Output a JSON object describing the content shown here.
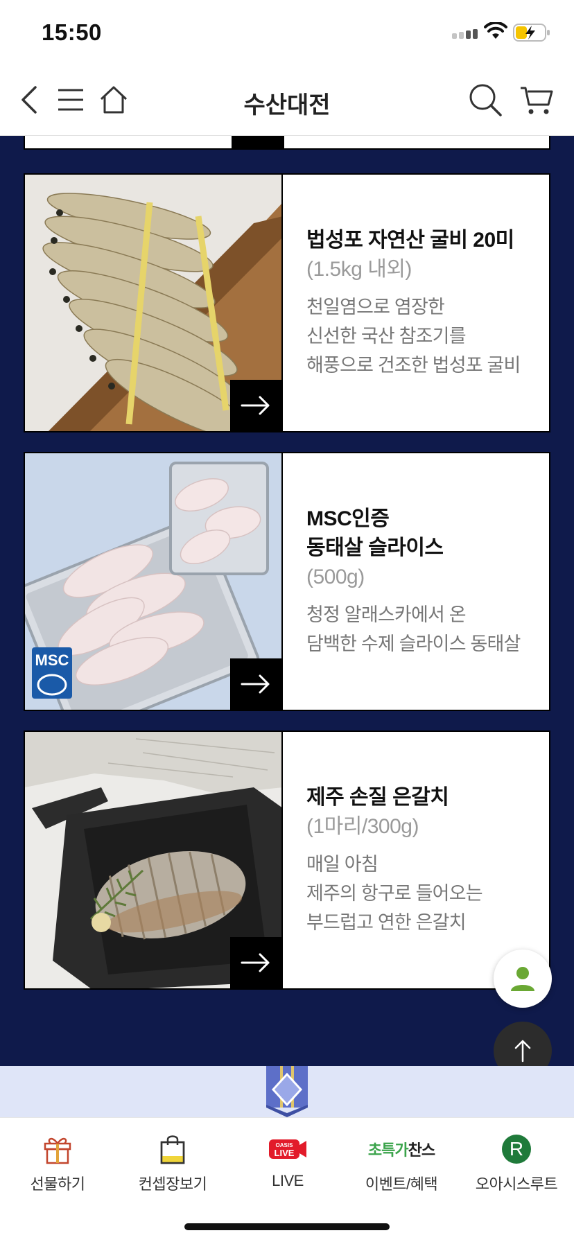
{
  "status_bar": {
    "time": "15:50"
  },
  "nav": {
    "title": "수산대전"
  },
  "products": [
    {
      "name_lines": [
        "법성포 자연산 굴비 20미"
      ],
      "weight": "(1.5kg 내외)",
      "desc_lines": [
        "천일염으로 염장한",
        "신선한 국산 참조기를",
        "해풍으로 건조한 법성포 굴비"
      ]
    },
    {
      "name_lines": [
        "MSC인증",
        "동태살 슬라이스"
      ],
      "weight": "(500g)",
      "desc_lines": [
        "청정 알래스카에서 온",
        "담백한 수제 슬라이스 동태살"
      ],
      "badge": "MSC"
    },
    {
      "name_lines": [
        "제주 손질 은갈치"
      ],
      "weight": "(1마리/300g)",
      "desc_lines": [
        "매일 아침",
        "제주의 항구로 들어오는",
        "부드럽고 연한 은갈치"
      ]
    }
  ],
  "tabs": [
    {
      "label": "선물하기",
      "icon": "gift-icon"
    },
    {
      "label": "컨셉장보기",
      "icon": "shopping-bag-icon"
    },
    {
      "label": "LIVE",
      "icon": "oasis-live-icon",
      "icon_text_1": "OASIS",
      "icon_text_2": "LIVE"
    },
    {
      "label": "이벤트/혜택",
      "icon": "event-chance-icon",
      "icon_text_1": "초특가",
      "icon_text_2": "찬스"
    },
    {
      "label": "오아시스루트",
      "icon": "route-icon",
      "icon_text_1": "R"
    }
  ],
  "colors": {
    "page_bg": "#0f1a4b",
    "accent_green": "#6aa834",
    "live_red": "#e21b2a",
    "strip_bg": "#dfe5f8"
  }
}
